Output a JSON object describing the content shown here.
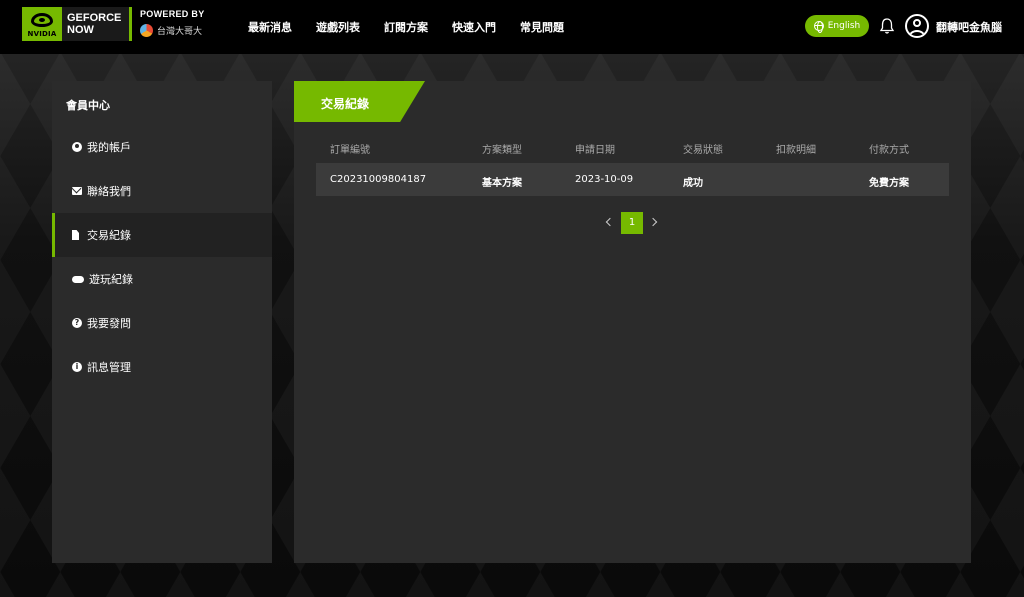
{
  "brand": {
    "nvidia_text": "NVIDIA",
    "product_line1": "GEFORCE",
    "product_line2": "NOW",
    "powered_by": "POWERED BY",
    "partner": "台灣大哥大",
    "accent_color": "#76b900"
  },
  "nav": {
    "items": [
      "最新消息",
      "遊戲列表",
      "訂閱方案",
      "快速入門",
      "常見問題"
    ],
    "language_button": "English",
    "username": "翻轉吧金魚腦"
  },
  "sidebar": {
    "title": "會員中心",
    "items": [
      {
        "label": "我的帳戶",
        "icon": "user-icon"
      },
      {
        "label": "聯絡我們",
        "icon": "mail-icon"
      },
      {
        "label": "交易紀錄",
        "icon": "document-icon",
        "active": true
      },
      {
        "label": "遊玩紀錄",
        "icon": "gamepad-icon"
      },
      {
        "label": "我要發問",
        "icon": "question-icon"
      },
      {
        "label": "訊息管理",
        "icon": "info-icon"
      }
    ]
  },
  "main": {
    "tab_title": "交易紀錄",
    "columns": [
      "訂單編號",
      "方案類型",
      "申請日期",
      "交易狀態",
      "扣款明細",
      "付款方式"
    ],
    "rows": [
      [
        "C20231009804187",
        "基本方案",
        "2023-10-09",
        "成功",
        "",
        "免費方案"
      ]
    ],
    "pagination": {
      "current_page": "1"
    }
  }
}
